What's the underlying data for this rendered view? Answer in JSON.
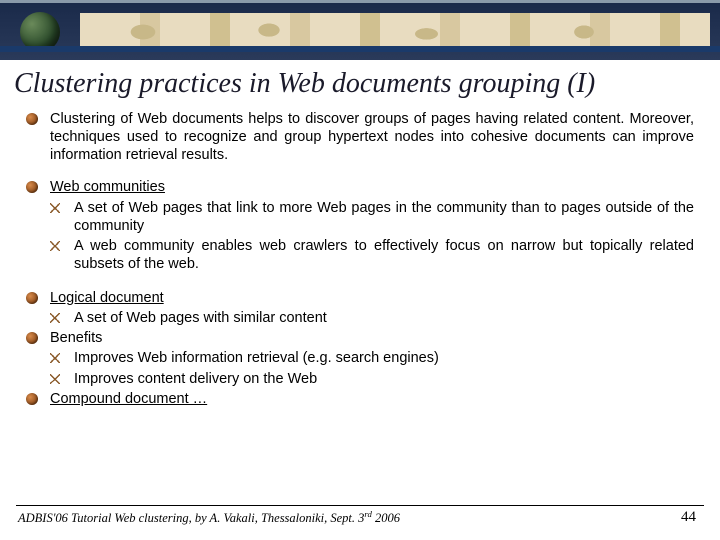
{
  "title": "Clustering practices in Web documents grouping (I)",
  "bullets": {
    "intro": "Clustering of Web documents helps to discover groups of pages having related content. Moreover, techniques used to recognize and group hypertext nodes into cohesive documents can improve information retrieval results.",
    "webcomm_title": "Web communities",
    "webcomm_sub1": "A set of Web pages that link to more Web pages in the community than to pages outside of the community",
    "webcomm_sub2": "A web community enables web crawlers to effectively focus on narrow but topically related subsets of the web.",
    "logical_title": "Logical document",
    "logical_sub1": "A set of Web pages with similar content",
    "benefits_title": "Benefits",
    "benefits_sub1": "Improves Web information retrieval (e.g. search engines)",
    "benefits_sub2": "Improves content delivery on the Web",
    "compound_title": "Compound document …"
  },
  "footer": {
    "text_prefix": "ADBIS'06 Tutorial Web clustering, by A. Vakali, Thessaloniki, Sept. 3",
    "text_suffix": " 2006",
    "ordinal": "rd"
  },
  "page_number": "44"
}
